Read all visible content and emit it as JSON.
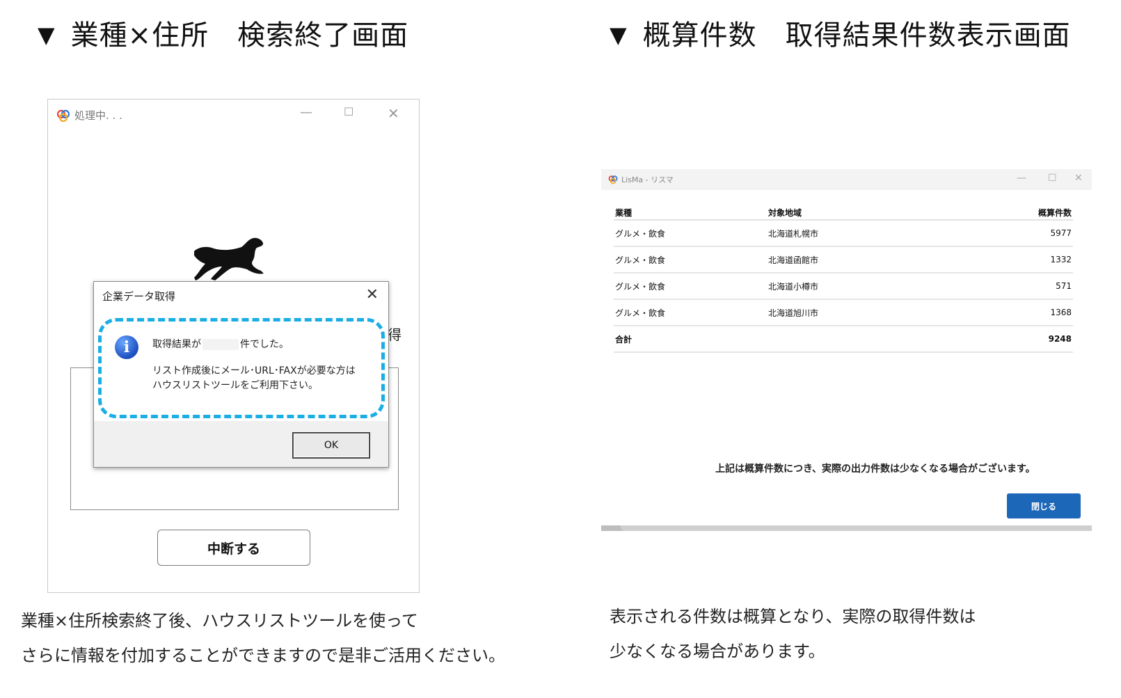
{
  "left_heading": "業種×住所　検索終了画面",
  "right_heading": "概算件数　取得結果件数表示画面",
  "heading_marker": "▼",
  "processing_window": {
    "title": "処理中. . .",
    "cancel_label": "中断する",
    "partial_char": "得"
  },
  "dialog": {
    "title": "企業データ取得",
    "message_prefix": "取得結果が",
    "message_suffix": "件でした。",
    "message_line2": "リスト作成後にメール･URL･FAXが必要な方は",
    "message_line3": "ハウスリストツールをご利用下さい。",
    "ok_label": "OK"
  },
  "result_window": {
    "title": "LisMa - リスマ",
    "columns": [
      "業種",
      "対象地域",
      "概算件数"
    ],
    "rows": [
      {
        "industry": "グルメ・飲食",
        "area": "北海道札幌市",
        "count": "5977"
      },
      {
        "industry": "グルメ・飲食",
        "area": "北海道函館市",
        "count": "1332"
      },
      {
        "industry": "グルメ・飲食",
        "area": "北海道小樽市",
        "count": "571"
      },
      {
        "industry": "グルメ・飲食",
        "area": "北海道旭川市",
        "count": "1368"
      }
    ],
    "total_label": "合計",
    "total_count": "9248",
    "note": "上記は概算件数につき、実際の出力件数は少なくなる場合がございます。",
    "close_label": "閉じる"
  },
  "left_caption": {
    "line1": "業種×住所検索終了後、ハウスリストツールを使って",
    "line2": "さらに情報を付加することができますので是非ご活用ください。"
  },
  "right_caption": {
    "line1": "表示される件数は概算となり、実際の取得件数は",
    "line2": "少なくなる場合があります。"
  },
  "colors": {
    "dash_highlight": "#1aaee5",
    "close_button": "#1c67b8"
  },
  "icons": [
    "triangle-down-icon",
    "app-logo-icon",
    "minimize-icon",
    "maximize-icon",
    "close-icon",
    "dog-silhouette-icon",
    "info-icon"
  ]
}
